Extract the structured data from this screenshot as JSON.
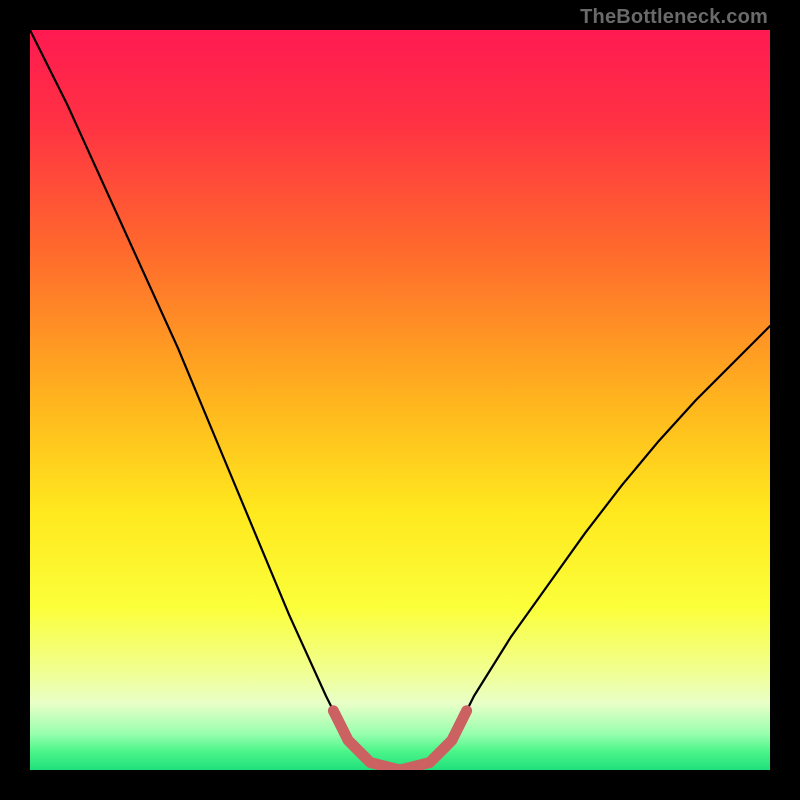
{
  "watermark": "TheBottleneck.com",
  "chart_data": {
    "type": "line",
    "title": "",
    "xlabel": "",
    "ylabel": "",
    "xlim": [
      0,
      100
    ],
    "ylim": [
      0,
      100
    ],
    "x": [
      0,
      5,
      10,
      15,
      20,
      25,
      30,
      35,
      40,
      43,
      46,
      50,
      54,
      57,
      60,
      65,
      70,
      75,
      80,
      85,
      90,
      95,
      100
    ],
    "values": [
      100,
      90,
      79,
      68,
      57,
      45,
      33,
      21,
      10,
      4,
      1,
      0,
      1,
      4,
      10,
      18,
      25,
      32,
      38.5,
      44.5,
      50,
      55,
      60
    ],
    "highlight_range_x": [
      41,
      59
    ],
    "gradient_stops": [
      {
        "pos": 0.0,
        "color": "#ff1a52"
      },
      {
        "pos": 0.12,
        "color": "#ff3044"
      },
      {
        "pos": 0.3,
        "color": "#ff6a2c"
      },
      {
        "pos": 0.5,
        "color": "#ffb41e"
      },
      {
        "pos": 0.65,
        "color": "#ffe81e"
      },
      {
        "pos": 0.78,
        "color": "#fbff3a"
      },
      {
        "pos": 0.86,
        "color": "#f2ff8a"
      },
      {
        "pos": 0.91,
        "color": "#e8ffc8"
      },
      {
        "pos": 0.95,
        "color": "#9bffb0"
      },
      {
        "pos": 0.975,
        "color": "#4cf58a"
      },
      {
        "pos": 1.0,
        "color": "#1fe07a"
      }
    ],
    "highlight_color": "#cb6160",
    "curve_color": "#000000"
  }
}
